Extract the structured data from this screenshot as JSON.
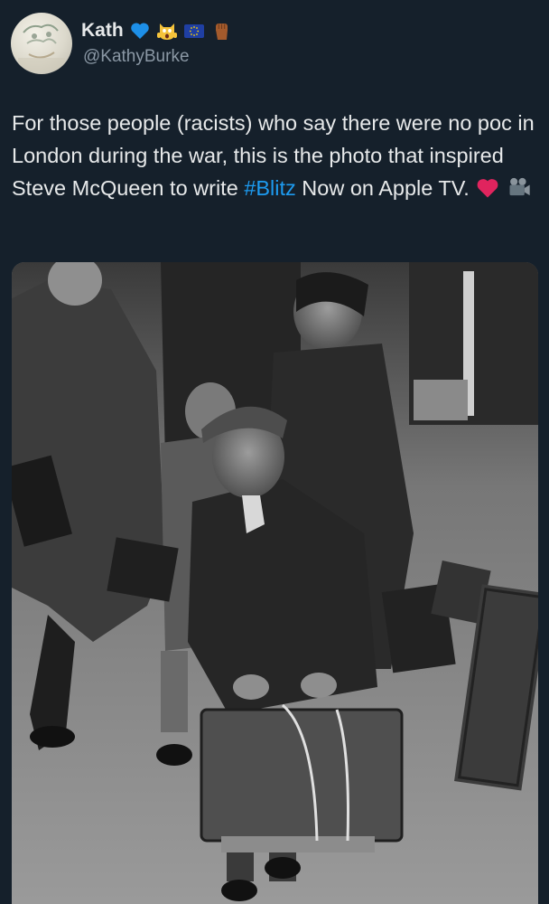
{
  "author": {
    "display_name": "Kath",
    "handle": "@KathyBurke",
    "name_emojis": [
      "blue-heart-icon",
      "screaming-cat-icon",
      "eu-flag-icon",
      "raised-fist-icon"
    ]
  },
  "tweet": {
    "text_before_hashtag": "For those people (racists) who say there were no poc in London during the war, this is the photo that inspired Steve McQueen to write ",
    "hashtag": "#Blitz",
    "text_after_hashtag": " Now on Apple TV.",
    "trailing_emojis": [
      "red-heart-icon",
      "movie-camera-icon"
    ]
  },
  "media": {
    "kind": "black-and-white photograph"
  },
  "colors": {
    "background": "#15202b",
    "text": "#e7e9ea",
    "secondary_text": "#8b98a5",
    "link": "#1d9bf0"
  }
}
